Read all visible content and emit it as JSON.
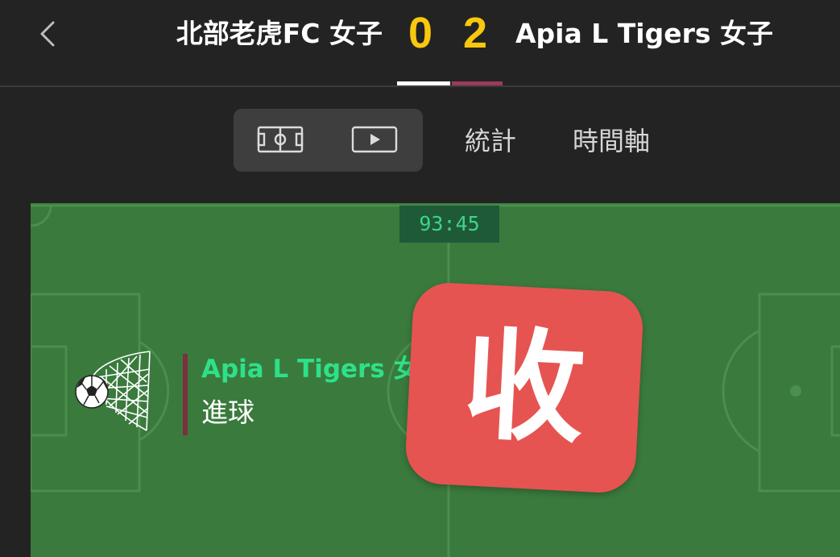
{
  "header": {
    "home_team": "北部老虎FC 女子",
    "away_team": "Apia L Tigers 女子",
    "home_score": "0",
    "away_score": "2",
    "back_icon": "chevron-left-icon",
    "score_color": "#f9c80e",
    "home_color": "#ffffff",
    "away_color": "#9c3a5a"
  },
  "tabs": {
    "field_icon": "pitch-icon",
    "video_icon": "play-icon",
    "stats_label": "統計",
    "timeline_label": "時間軸"
  },
  "pitch": {
    "clock": "93:45",
    "event": {
      "icon": "goal-net-icon",
      "team": "Apia L Tigers 女子",
      "type": "進球"
    }
  },
  "overlay": {
    "text": "收",
    "color": "#e55451"
  }
}
